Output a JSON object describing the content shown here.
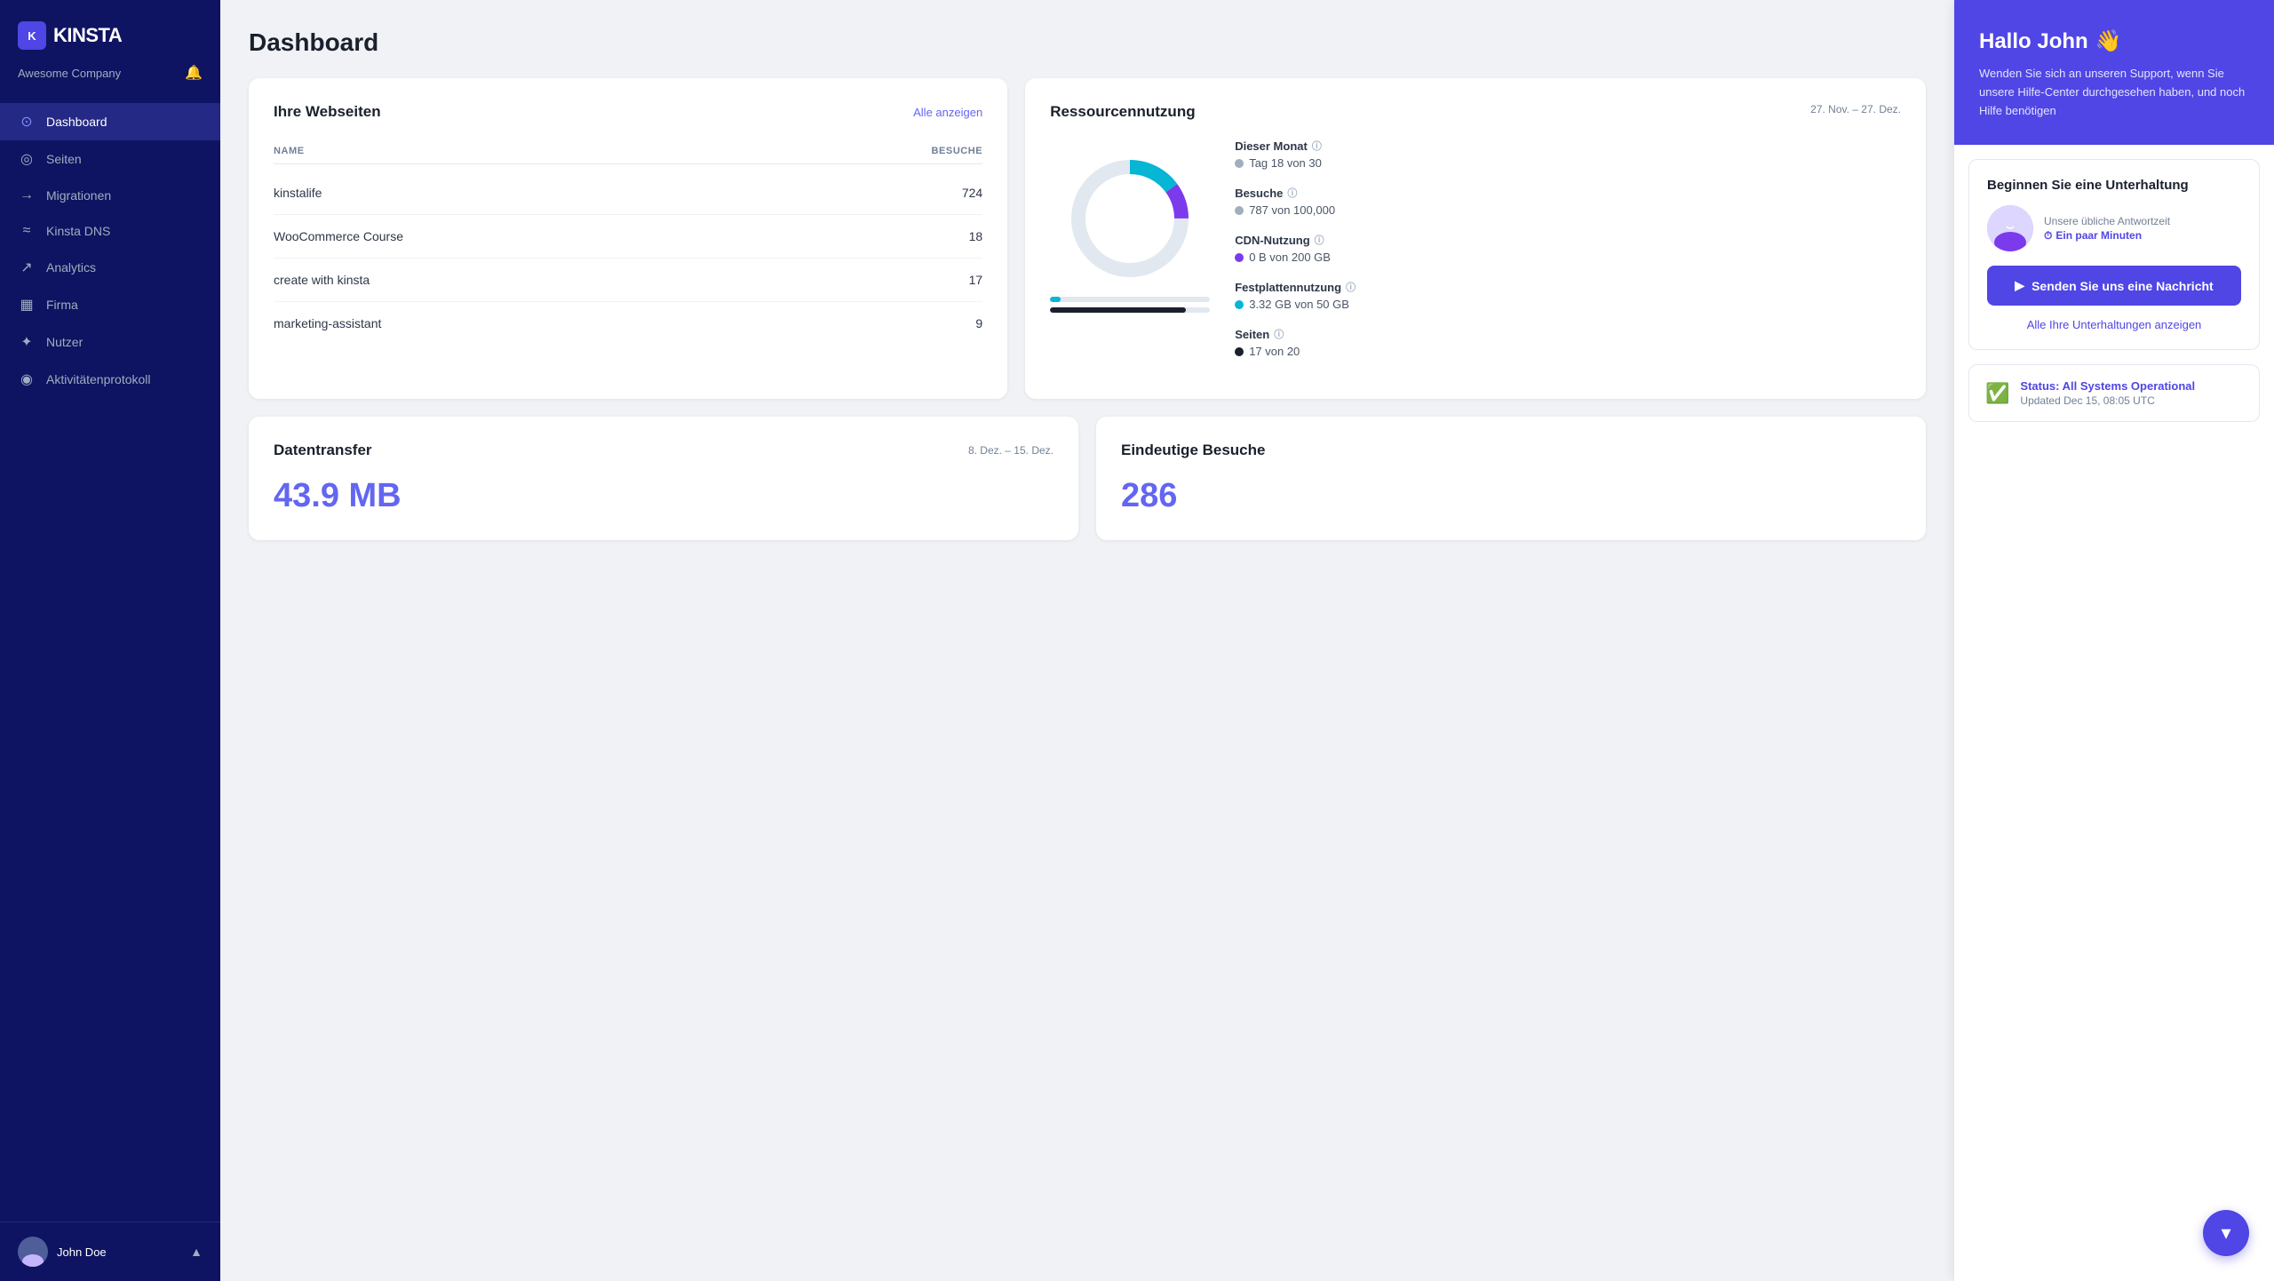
{
  "sidebar": {
    "logo": "KINSTA",
    "company": "Awesome Company",
    "bell_icon": "🔔",
    "nav_items": [
      {
        "id": "dashboard",
        "label": "Dashboard",
        "icon": "⊙",
        "active": true
      },
      {
        "id": "seiten",
        "label": "Seiten",
        "icon": "◎",
        "active": false
      },
      {
        "id": "migrationen",
        "label": "Migrationen",
        "icon": "→",
        "active": false
      },
      {
        "id": "kinsta-dns",
        "label": "Kinsta DNS",
        "icon": "≈",
        "active": false
      },
      {
        "id": "analytics",
        "label": "Analytics",
        "icon": "↗",
        "active": false
      },
      {
        "id": "firma",
        "label": "Firma",
        "icon": "▦",
        "active": false
      },
      {
        "id": "nutzer",
        "label": "Nutzer",
        "icon": "✦",
        "active": false
      },
      {
        "id": "aktivitaetsprotokoll",
        "label": "Aktivitätenprotokoll",
        "icon": "◉",
        "active": false
      }
    ],
    "user": {
      "name": "John Doe",
      "chevron": "▲"
    }
  },
  "page": {
    "title": "Dashboard"
  },
  "webseiten_card": {
    "title": "Ihre Webseiten",
    "link": "Alle anzeigen",
    "col_name": "NAME",
    "col_visits": "BESUCHE",
    "sites": [
      {
        "name": "kinstalife",
        "visits": "724"
      },
      {
        "name": "WooCommerce Course",
        "visits": "18"
      },
      {
        "name": "create with kinsta",
        "visits": "17"
      },
      {
        "name": "marketing-assistant",
        "visits": "9"
      }
    ]
  },
  "ressourcen_card": {
    "title": "Ressourcennutzung",
    "date_range": "27. Nov. – 27. Dez.",
    "stats": [
      {
        "id": "monat",
        "label": "Dieser Monat",
        "value": "Tag 18 von 30",
        "dot": "gray"
      },
      {
        "id": "besuche",
        "label": "Besuche",
        "value": "787 von 100,000",
        "dot": "gray"
      },
      {
        "id": "cdn",
        "label": "CDN-Nutzung",
        "value": "0 B von 200 GB",
        "dot": "purple"
      },
      {
        "id": "festplatte",
        "label": "Festplattennutzung",
        "value": "3.32 GB von 50 GB",
        "dot": "cyan"
      },
      {
        "id": "seiten",
        "label": "Seiten",
        "value": "17 von 20",
        "dot": "dark"
      }
    ],
    "donut": {
      "segments": [
        {
          "color": "#06b6d4",
          "percent": 15,
          "offset": 0
        },
        {
          "color": "#7c3aed",
          "percent": 10,
          "offset": 15
        },
        {
          "color": "#e2e8f0",
          "percent": 75,
          "offset": 25
        }
      ]
    },
    "progress_bars": [
      {
        "label": "Festplatten",
        "percent": 6.64,
        "color": "#06b6d4"
      },
      {
        "label": "Seiten",
        "percent": 85,
        "color": "#1a202c"
      }
    ]
  },
  "datentransfer_card": {
    "title": "Datentransfer",
    "date_range": "8. Dez. – 15. Dez.",
    "value": "43.9 MB"
  },
  "besuche_card": {
    "title": "Eindeutige Besuche",
    "value": "286"
  },
  "side_panel": {
    "greeting": "Hallo John",
    "wave": "👋",
    "subtitle": "Wenden Sie sich an unseren Support, wenn Sie unsere Hilfe-Center durchgesehen haben, und noch Hilfe benötigen",
    "chat_title": "Beginnen Sie eine Unterhaltung",
    "agent_response_label": "Unsere übliche Antwortzeit",
    "agent_time_icon": "⏱",
    "agent_time": "Ein paar Minuten",
    "send_button": "Senden Sie uns eine Nachricht",
    "send_icon": "▶",
    "all_conversations": "Alle Ihre Unterhaltungen anzeigen",
    "status_text": "Status: All Systems Operational",
    "status_updated": "Updated Dec 15, 08:05 UTC"
  },
  "fab": {
    "icon": "∨"
  }
}
